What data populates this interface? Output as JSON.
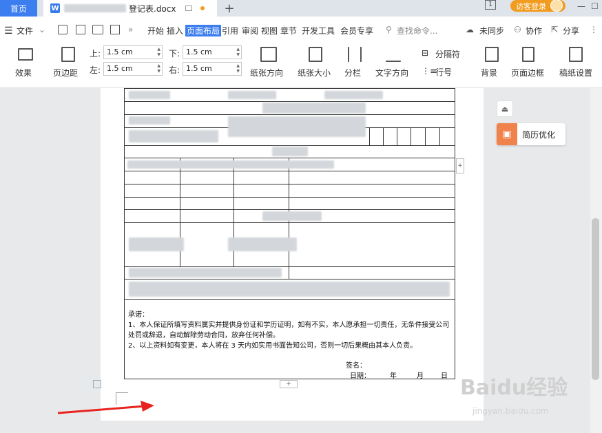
{
  "tabs": {
    "home": "首页",
    "doc_icon": "W",
    "doc_title": "登记表.docx"
  },
  "login": {
    "label": "访客登录"
  },
  "window": {
    "count": "1",
    "minimize": "—",
    "maximize": "☐"
  },
  "menu": {
    "file": "文件",
    "items": [
      "开始",
      "插入",
      "页面布局",
      "引用",
      "审阅",
      "视图",
      "章节",
      "开发工具",
      "会员专享"
    ],
    "active": "页面布局",
    "search_placeholder": "查找命令...",
    "sync": "未同步",
    "collab": "协作",
    "share": "分享"
  },
  "ribbon": {
    "effects": "效果",
    "margins": "页边距",
    "top_label": "上:",
    "top_value": "1.5 cm",
    "bottom_label": "下:",
    "bottom_value": "1.5 cm",
    "left_label": "左:",
    "left_value": "1.5 cm",
    "right_label": "右:",
    "right_value": "1.5 cm",
    "orientation": "纸张方向",
    "size": "纸张大小",
    "columns": "分栏",
    "text_direction": "文字方向",
    "separator": "分隔符",
    "line_numbers": "行号",
    "background": "背景",
    "page_border": "页面边框",
    "grid_paper": "稿纸设置"
  },
  "document": {
    "promise_title": "承诺：",
    "promise_1": "1、本人保证所填写资料属实并提供身份证和学历证明，如有不实，本人愿承担一切责任，无条件接受公司处罚或辞退，自动解除劳动合同，放弃任何补偿。",
    "promise_2": "2、以上资料如有变更，本人将在 3 天内如实用书面告知公司，否则一切后果概由其本人负责。",
    "sign_label": "签名：",
    "date_label": "日期：",
    "year": "年",
    "month": "月",
    "day": "日"
  },
  "side_panel": {
    "resume": "简历优化"
  },
  "watermark": {
    "logo": "Baidu经验",
    "url": "jingyan.baidu.com"
  },
  "colors": {
    "accent": "#3c7ef0",
    "login": "#f19c1f",
    "resume": "#f0834b",
    "arrow": "#e8231f"
  }
}
